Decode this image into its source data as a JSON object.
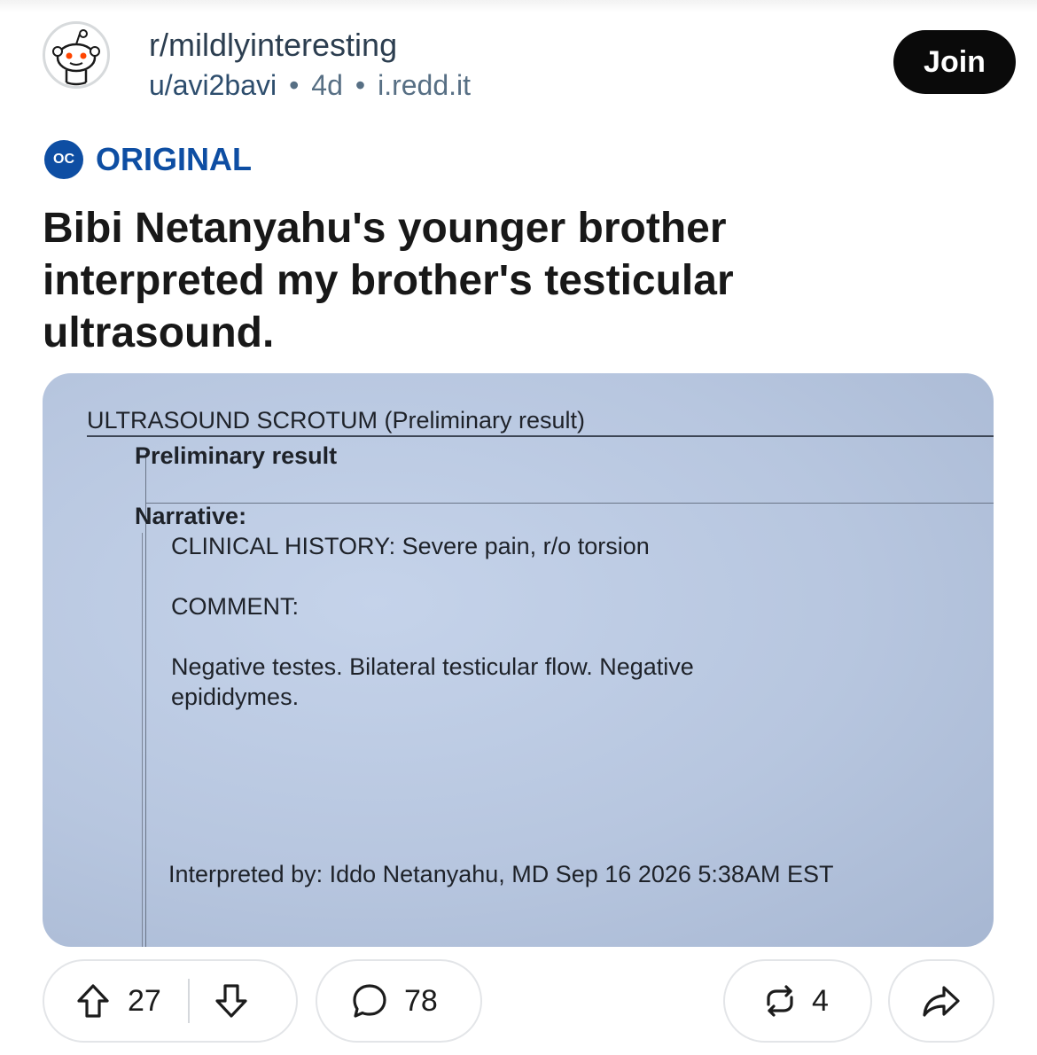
{
  "post": {
    "subreddit": "r/mildlyinteresting",
    "author": "u/avi2bavi",
    "age": "4d",
    "domain": "i.redd.it",
    "join_label": "Join",
    "flair_badge": "OC",
    "flair_label": "ORIGINAL",
    "title": "Bibi Netanyahu's younger brother interpreted my brother's testicular ultrasound.",
    "separator": "•"
  },
  "image": {
    "header": "ULTRASOUND SCROTUM (Preliminary result)",
    "subheader": "Preliminary result",
    "narrative_label": "Narrative:",
    "clinical_history": "CLINICAL HISTORY: Severe pain, r/o torsion",
    "comment_label": "COMMENT:",
    "comment_line1": "Negative testes.  Bilateral testicular flow.  Negative",
    "comment_line2": "epididymes.",
    "interpreted_by": "Interpreted by: Iddo Netanyahu, MD Sep 16 2026  5:38AM EST"
  },
  "actions": {
    "upvotes": "27",
    "comments": "78",
    "crossposts": "4"
  },
  "colors": {
    "accent": "#0e4ea3",
    "join_bg": "#0a0a0a",
    "paper": "#b7c6df"
  },
  "icons": [
    "snoo-avatar-icon",
    "oc-badge-icon",
    "upvote-icon",
    "downvote-icon",
    "comment-icon",
    "crosspost-icon",
    "share-icon"
  ]
}
